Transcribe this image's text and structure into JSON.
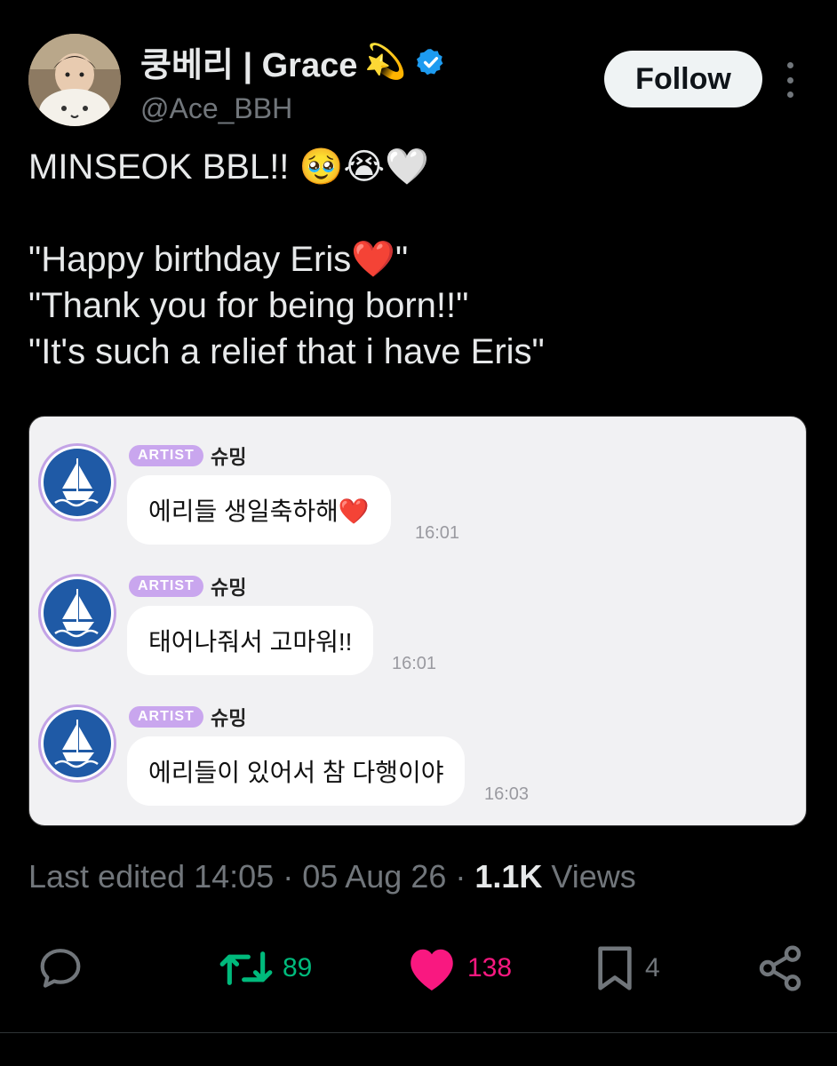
{
  "author": {
    "display_name": "쿵베리 | Grace",
    "name_emoji": "💫",
    "handle": "@Ace_BBH",
    "verified": true
  },
  "follow_label": "Follow",
  "tweet": {
    "line1": "MINSEOK BBL!! 🥹😭🤍",
    "line2": "\"Happy birthday Eris❤️\"",
    "line3": "\"Thank you for being born!!\"",
    "line4": "\"It's such a relief that i have Eris\""
  },
  "chat": {
    "messages": [
      {
        "badge": "ARTIST",
        "sender": "슈밍",
        "text": "에리들 생일축하해❤️",
        "time": "16:01"
      },
      {
        "badge": "ARTIST",
        "sender": "슈밍",
        "text": "태어나줘서 고마워!!",
        "time": "16:01"
      },
      {
        "badge": "ARTIST",
        "sender": "슈밍",
        "text": "에리들이 있어서 참 다행이야",
        "time": "16:03"
      }
    ]
  },
  "meta": {
    "edited": "Last edited 14:05 · 05 Aug 26 · ",
    "views_count": "1.1K",
    "views_label": " Views"
  },
  "actions": {
    "retweets": "89",
    "likes": "138",
    "bookmarks": "4"
  },
  "colors": {
    "retweet": "#00ba7c",
    "like": "#f91880",
    "verified": "#1d9bf0",
    "artist_badge": "#c9a6ee"
  }
}
